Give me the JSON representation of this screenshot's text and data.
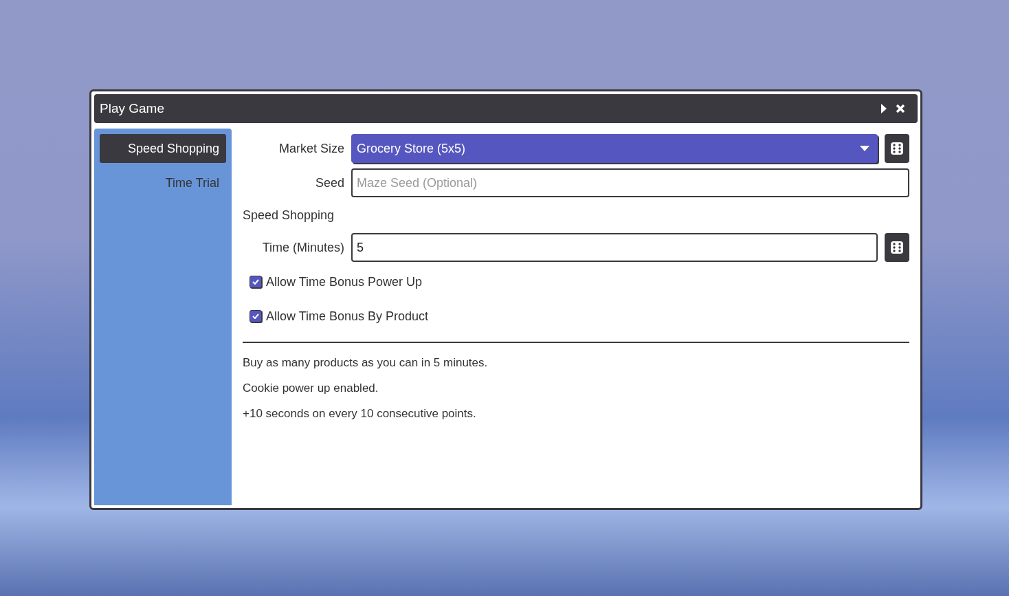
{
  "window": {
    "title": "Play Game"
  },
  "sidebar": {
    "items": [
      {
        "label": "Speed Shopping",
        "selected": true
      },
      {
        "label": "Time Trial",
        "selected": false
      }
    ]
  },
  "form": {
    "market_size": {
      "label": "Market Size",
      "value": "Grocery Store (5x5)"
    },
    "seed": {
      "label": "Seed",
      "placeholder": "Maze Seed (Optional)"
    },
    "section_title": "Speed Shopping",
    "time": {
      "label": "Time (Minutes)",
      "value": "5"
    },
    "options": [
      {
        "label": "Allow Time Bonus Power Up",
        "checked": true
      },
      {
        "label": "Allow Time Bonus By Product",
        "checked": true
      }
    ]
  },
  "description": [
    "Buy as many products as you can in 5 minutes.",
    "Cookie power up enabled.",
    "+10 seconds on every 10 consecutive points."
  ]
}
